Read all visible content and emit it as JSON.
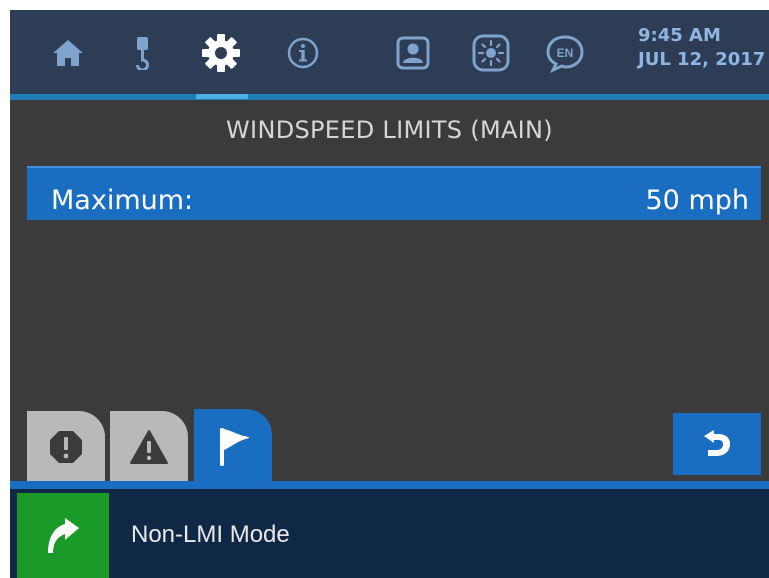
{
  "header": {
    "time": "9:45 AM",
    "date": "JUL 12, 2017",
    "nav_icons": [
      "home-icon",
      "crane-hook-icon",
      "gear-icon",
      "info-icon",
      "operator-profile-icon",
      "brightness-icon",
      "language-icon"
    ],
    "language_code": "EN",
    "active_tab": "gear-icon"
  },
  "page": {
    "title": "WINDSPEED LIMITS (MAIN)",
    "setting": {
      "label": "Maximum:",
      "value": "50 mph"
    }
  },
  "tabs": [
    {
      "icon": "stop-alarm-icon",
      "glyph": "!",
      "active": false
    },
    {
      "icon": "warning-icon",
      "glyph": "!",
      "active": false
    },
    {
      "icon": "flag-icon",
      "active": true
    }
  ],
  "footer": {
    "mode_label": "Non-LMI Mode",
    "mode_icon": "bypass-arrow-icon"
  },
  "colors": {
    "topbar": "#2c3d55",
    "accent_blue": "#1a6ec2",
    "background": "#3b3b3b",
    "bottombar": "#0f2846",
    "mode_green": "#1a9b29",
    "clock_text": "#8fb6e3"
  }
}
